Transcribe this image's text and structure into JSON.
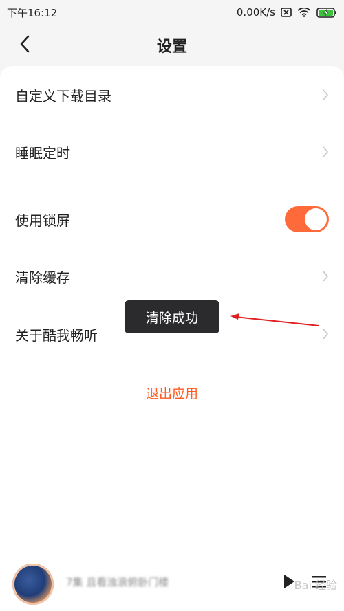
{
  "status_bar": {
    "time": "下午16:12",
    "network_speed": "0.00K/s",
    "icons": [
      "sim-x-icon",
      "wifi-icon",
      "battery-charging-icon"
    ]
  },
  "header": {
    "back_icon": "chevron-left-icon",
    "title": "设置"
  },
  "settings": {
    "items": [
      {
        "label": "自定义下载目录",
        "control": "chevron"
      },
      {
        "label": "睡眠定时",
        "control": "chevron"
      },
      {
        "label": "使用锁屏",
        "control": "toggle",
        "toggle_on": true
      },
      {
        "label": "清除缓存",
        "control": "chevron"
      },
      {
        "label": "关于酷我畅听",
        "control": "chevron"
      }
    ],
    "exit_label": "退出应用"
  },
  "toast": {
    "message": "清除成功"
  },
  "mini_player": {
    "track_title": "7集 且看浊浪俯卧门楼",
    "watermark": "Bai 经验"
  },
  "colors": {
    "accent": "#ff6a3a",
    "exit_text": "#ff5a1f",
    "toast_bg": "#2b2b2e",
    "annotation_red": "#e02020",
    "background": "#f5f5f5",
    "card": "#ffffff"
  }
}
